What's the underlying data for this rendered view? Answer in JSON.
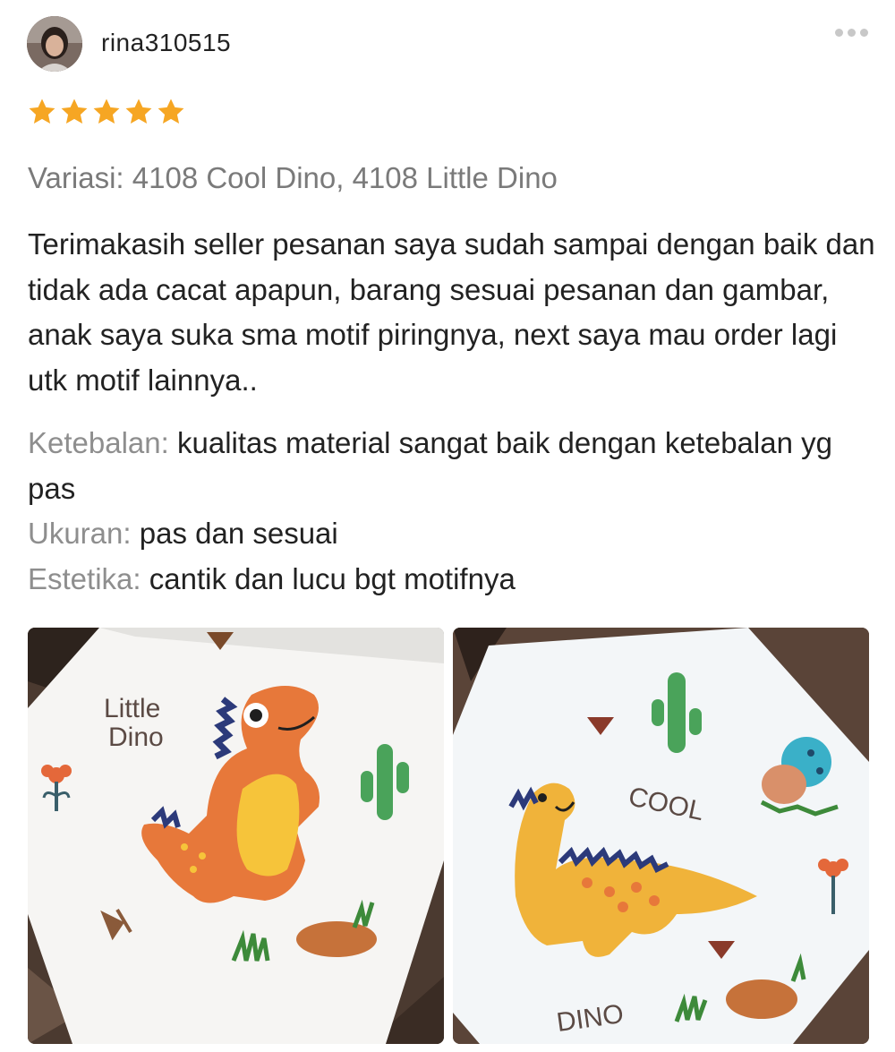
{
  "review": {
    "username": "rina310515",
    "rating": 5,
    "rating_max": 5,
    "star_color": "#f6a623",
    "variation": "Variasi: 4108 Cool Dino, 4108 Little Dino",
    "text": "Terimakasih seller pesanan saya sudah sampai dengan baik dan tidak ada cacat apapun, barang sesuai pesanan dan gambar, anak saya suka sma motif piringnya, next saya mau order lagi utk motif lainnya..",
    "attributes": [
      {
        "label": "Ketebalan:",
        "value": "kualitas material sangat baik dengan ketebalan yg pas"
      },
      {
        "label": "Ukuran:",
        "value": "pas dan sesuai"
      },
      {
        "label": "Estetika:",
        "value": "cantik dan lucu bgt motifnya"
      }
    ],
    "photos": [
      {
        "name": "little-dino-plate",
        "text_line1": "Little",
        "text_line2": "Dino"
      },
      {
        "name": "cool-dino-plate",
        "text_cool": "COOL",
        "text_dino": "DINO"
      }
    ]
  },
  "icons": {
    "more": "more-options-icon",
    "star": "star-icon",
    "avatar": "user-avatar"
  }
}
